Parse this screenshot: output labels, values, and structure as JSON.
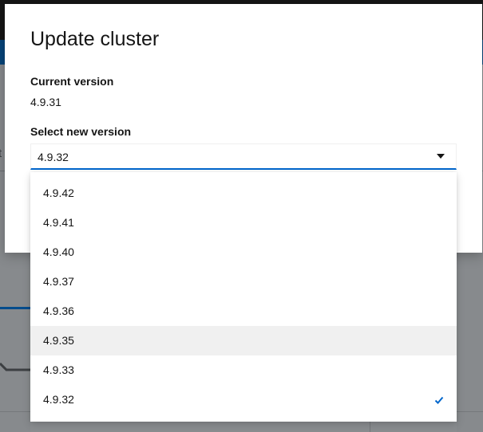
{
  "modal": {
    "title": "Update cluster",
    "current_version_label": "Current version",
    "current_version_value": "4.9.31",
    "select_label": "Select new version",
    "selected_value": "4.9.32"
  },
  "dropdown": {
    "items": [
      {
        "label": "4.9.42",
        "selected": false,
        "hovered": false
      },
      {
        "label": "4.9.41",
        "selected": false,
        "hovered": false
      },
      {
        "label": "4.9.40",
        "selected": false,
        "hovered": false
      },
      {
        "label": "4.9.37",
        "selected": false,
        "hovered": false
      },
      {
        "label": "4.9.36",
        "selected": false,
        "hovered": false
      },
      {
        "label": "4.9.35",
        "selected": false,
        "hovered": true
      },
      {
        "label": "4.9.33",
        "selected": false,
        "hovered": false
      },
      {
        "label": "4.9.32",
        "selected": true,
        "hovered": false
      }
    ]
  },
  "background": {
    "stub_text": "t"
  },
  "colors": {
    "accent": "#0066cc",
    "hover_bg": "#f0f0f0",
    "backdrop": "#8a8d90",
    "check": "#0066cc"
  },
  "icons": {
    "toggle": "caret-down-icon",
    "selected": "check-icon"
  }
}
